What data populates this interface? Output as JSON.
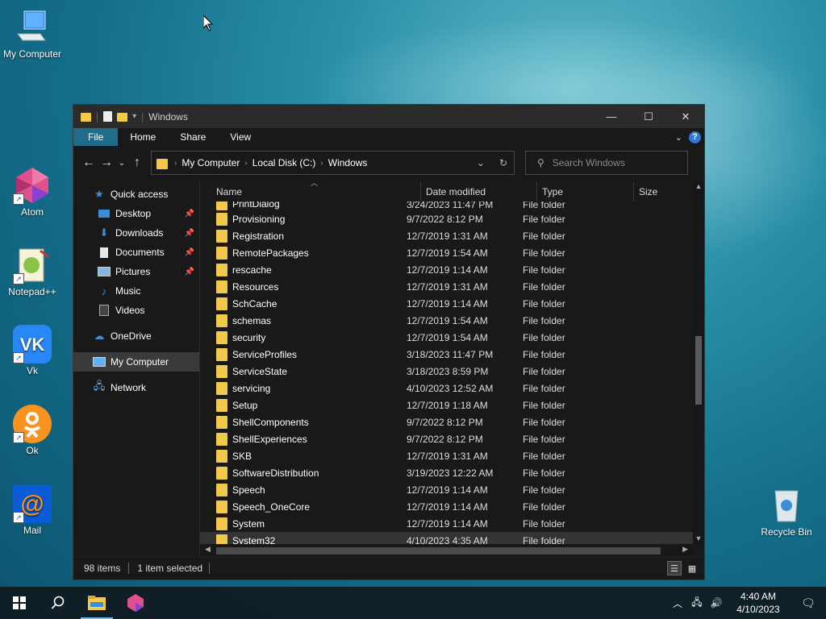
{
  "desktop": {
    "icons": [
      {
        "label": "My Computer",
        "icon": "computer-icon"
      },
      {
        "label": "Atom",
        "icon": "atom-icon"
      },
      {
        "label": "Notepad++",
        "icon": "notepadpp-icon"
      },
      {
        "label": "Vk",
        "icon": "vk-icon"
      },
      {
        "label": "Ok",
        "icon": "ok-icon"
      },
      {
        "label": "Mail",
        "icon": "mail-icon"
      },
      {
        "label": "Recycle Bin",
        "icon": "recycle-bin-icon"
      }
    ]
  },
  "window": {
    "title": "Windows",
    "controls": {
      "minimize": "—",
      "maximize": "☐",
      "close": "✕"
    },
    "ribbon_tabs": [
      "File",
      "Home",
      "Share",
      "View"
    ],
    "address": {
      "crumbs": [
        "My Computer",
        "Local Disk (C:)",
        "Windows"
      ]
    },
    "search": {
      "placeholder": "Search Windows"
    },
    "nav": {
      "quick_access": "Quick access",
      "items": [
        {
          "label": "Desktop",
          "icon": "desktop-icon"
        },
        {
          "label": "Downloads",
          "icon": "downloads-icon"
        },
        {
          "label": "Documents",
          "icon": "documents-icon"
        },
        {
          "label": "Pictures",
          "icon": "pictures-icon"
        },
        {
          "label": "Music",
          "icon": "music-icon"
        },
        {
          "label": "Videos",
          "icon": "videos-icon"
        }
      ],
      "onedrive": "OneDrive",
      "my_computer": "My Computer",
      "network": "Network"
    },
    "columns": {
      "name": "Name",
      "date": "Date modified",
      "type": "Type",
      "size": "Size"
    },
    "partial_row": {
      "name": "PrintDialog",
      "date": "3/24/2023 11:47 PM",
      "type": "File folder"
    },
    "rows": [
      {
        "name": "Provisioning",
        "date": "9/7/2022 8:12 PM",
        "type": "File folder"
      },
      {
        "name": "Registration",
        "date": "12/7/2019 1:31 AM",
        "type": "File folder"
      },
      {
        "name": "RemotePackages",
        "date": "12/7/2019 1:54 AM",
        "type": "File folder"
      },
      {
        "name": "rescache",
        "date": "12/7/2019 1:14 AM",
        "type": "File folder"
      },
      {
        "name": "Resources",
        "date": "12/7/2019 1:31 AM",
        "type": "File folder"
      },
      {
        "name": "SchCache",
        "date": "12/7/2019 1:14 AM",
        "type": "File folder"
      },
      {
        "name": "schemas",
        "date": "12/7/2019 1:54 AM",
        "type": "File folder"
      },
      {
        "name": "security",
        "date": "12/7/2019 1:54 AM",
        "type": "File folder"
      },
      {
        "name": "ServiceProfiles",
        "date": "3/18/2023 11:47 PM",
        "type": "File folder"
      },
      {
        "name": "ServiceState",
        "date": "3/18/2023 8:59 PM",
        "type": "File folder"
      },
      {
        "name": "servicing",
        "date": "4/10/2023 12:52 AM",
        "type": "File folder"
      },
      {
        "name": "Setup",
        "date": "12/7/2019 1:18 AM",
        "type": "File folder"
      },
      {
        "name": "ShellComponents",
        "date": "9/7/2022 8:12 PM",
        "type": "File folder"
      },
      {
        "name": "ShellExperiences",
        "date": "9/7/2022 8:12 PM",
        "type": "File folder"
      },
      {
        "name": "SKB",
        "date": "12/7/2019 1:31 AM",
        "type": "File folder"
      },
      {
        "name": "SoftwareDistribution",
        "date": "3/19/2023 12:22 AM",
        "type": "File folder"
      },
      {
        "name": "Speech",
        "date": "12/7/2019 1:14 AM",
        "type": "File folder"
      },
      {
        "name": "Speech_OneCore",
        "date": "12/7/2019 1:14 AM",
        "type": "File folder"
      },
      {
        "name": "System",
        "date": "12/7/2019 1:14 AM",
        "type": "File folder"
      },
      {
        "name": "System32",
        "date": "4/10/2023 4:35 AM",
        "type": "File folder",
        "selected": true
      }
    ],
    "status": {
      "items": "98 items",
      "selected": "1 item selected"
    }
  },
  "taskbar": {
    "clock_time": "4:40 AM",
    "clock_date": "4/10/2023"
  }
}
